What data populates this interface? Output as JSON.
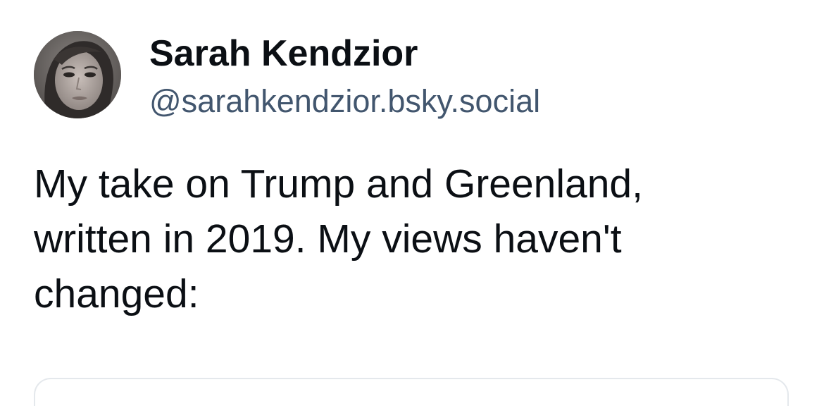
{
  "author": {
    "display_name": "Sarah Kendzior",
    "handle": "@sarahkendzior.bsky.social",
    "avatar_icon": "profile-photo"
  },
  "post": {
    "text": "My take on Trump and Greenland,\nwritten in 2019. My views haven't\nchanged:"
  },
  "colors": {
    "name_text": "#0b0f14",
    "handle_text": "#42566e",
    "body_text": "#0b0f14",
    "card_border": "#e4e8ec"
  }
}
